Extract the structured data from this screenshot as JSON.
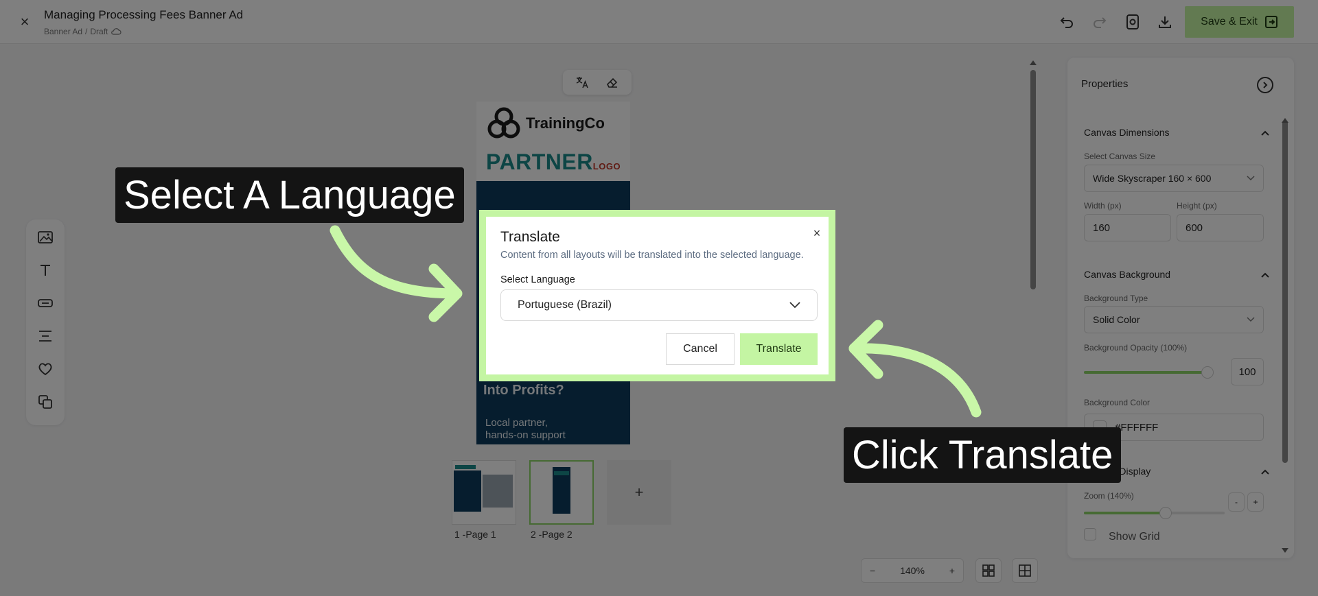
{
  "header": {
    "title": "Managing Processing Fees Banner Ad",
    "breadcrumb_type": "Banner Ad",
    "breadcrumb_sep": "/",
    "breadcrumb_status": "Draft",
    "save_label": "Save & Exit"
  },
  "banner": {
    "company": "TrainingCo",
    "partner": "PARTNER",
    "partner_logo": "LOGO",
    "headline": "Into Profits?",
    "sub_line1": "Local partner,",
    "sub_line2": "hands-on support"
  },
  "pages": [
    {
      "label": "1 -Page 1"
    },
    {
      "label": "2 -Page 2"
    }
  ],
  "add_page_label": "+",
  "zoom": {
    "minus": "−",
    "value": "140%",
    "plus": "+"
  },
  "properties": {
    "title": "Properties",
    "canvas_dimensions": {
      "heading": "Canvas Dimensions",
      "size_label": "Select Canvas Size",
      "size_value": "Wide Skyscraper 160 × 600",
      "width_label": "Width (px)",
      "width_value": "160",
      "height_label": "Height (px)",
      "height_value": "600"
    },
    "canvas_background": {
      "heading": "Canvas Background",
      "type_label": "Background Type",
      "type_value": "Solid Color",
      "opacity_label": "Background Opacity (100%)",
      "opacity_value": "100",
      "opacity_fraction": 1.0,
      "color_label": "Background Color",
      "color_value": "#FFFFFF"
    },
    "canvas_display": {
      "heading": "Canvas Display",
      "zoom_label": "Zoom (140%)",
      "zoom_fraction": 0.58,
      "zoom_minus": "-",
      "zoom_plus": "+",
      "grid_label": "Show Grid"
    }
  },
  "dialog": {
    "title": "Translate",
    "description": "Content from all layouts will be translated into the selected language.",
    "select_label": "Select Language",
    "selected_language": "Portuguese (Brazil)",
    "cancel_label": "Cancel",
    "translate_label": "Translate",
    "close_label": "×"
  },
  "callouts": {
    "select_language": "Select A Language",
    "click_translate": "Click Translate"
  },
  "colors": {
    "accent_green": "#c4f5a3",
    "arrow_green": "#c9f7a8",
    "banner_teal": "#1a8a8a",
    "banner_navy": "#0d3b5c"
  }
}
